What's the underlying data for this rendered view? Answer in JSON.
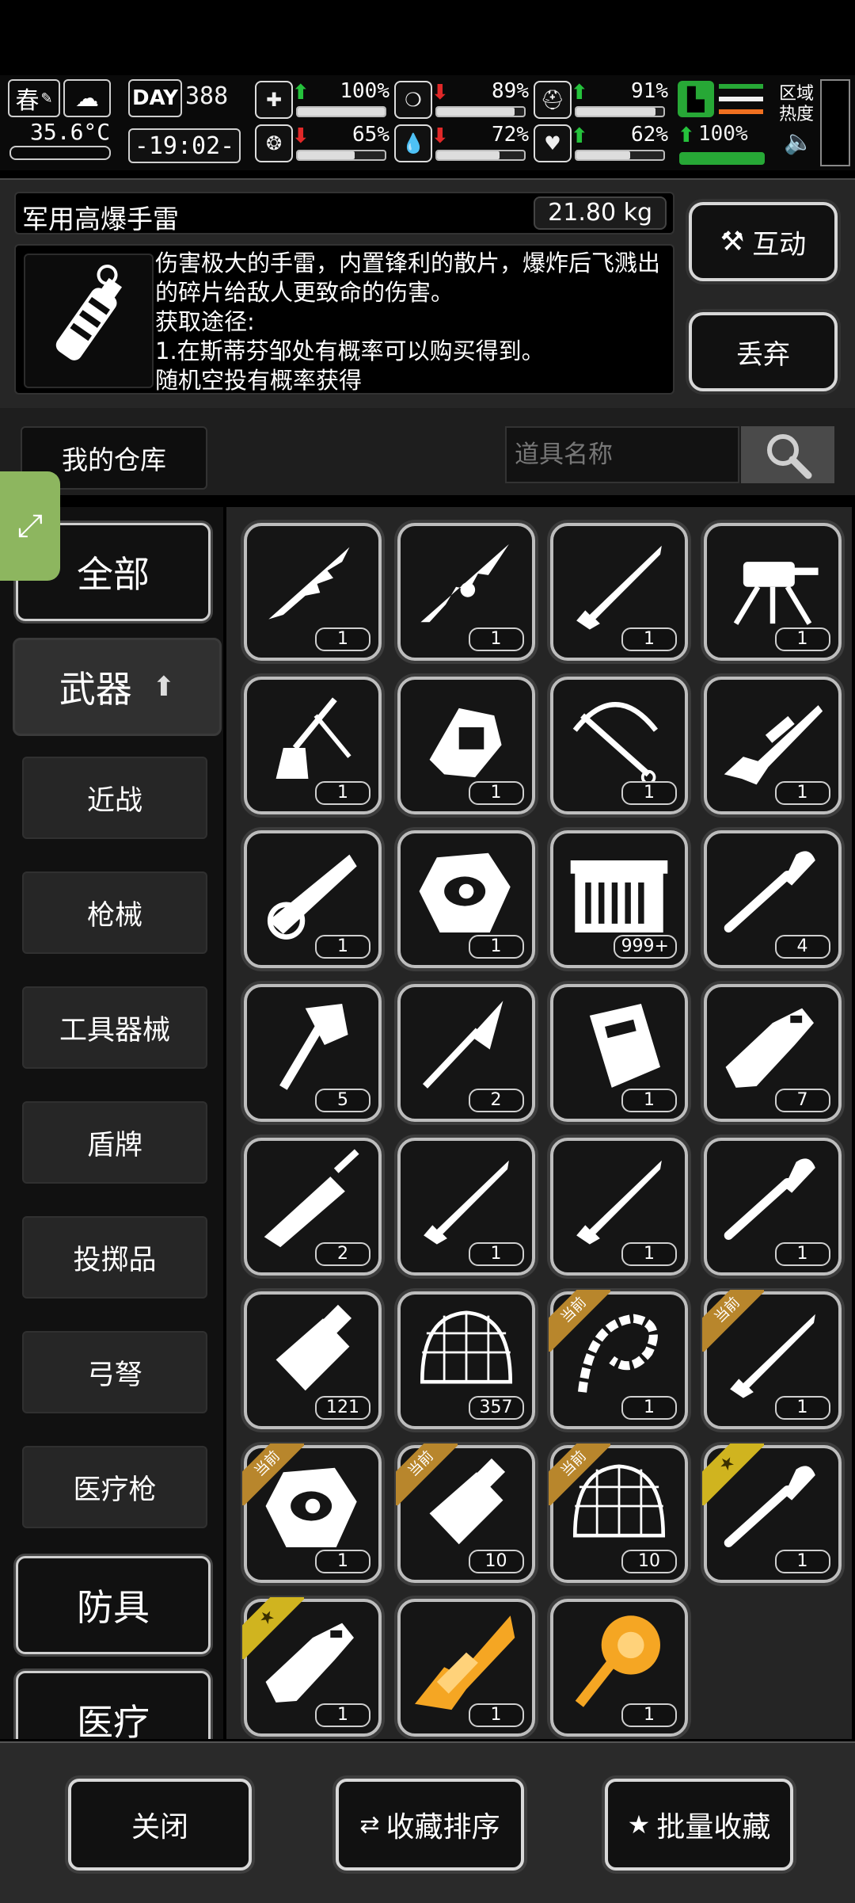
{
  "status": {
    "season": "春",
    "temperature": "35.6°C",
    "day_label": "DAY",
    "day_number": "388",
    "clock": "-19:02-",
    "region_heat_label": "区域\n热度",
    "stats": [
      {
        "name": "health",
        "icon": "medkit-icon",
        "trend": "up",
        "value": "100%",
        "level": 1.0
      },
      {
        "name": "hunger",
        "icon": "stomach-icon",
        "trend": "down",
        "value": "89%",
        "level": 0.89
      },
      {
        "name": "defense",
        "icon": "helmet-icon",
        "trend": "up",
        "value": "91%",
        "level": 0.91
      },
      {
        "name": "mind",
        "icon": "brain-icon",
        "trend": "down",
        "value": "65%",
        "level": 0.65
      },
      {
        "name": "water",
        "icon": "water-drop-icon",
        "trend": "down",
        "value": "72%",
        "level": 0.72
      },
      {
        "name": "mood",
        "icon": "heart-icon",
        "trend": "up",
        "value": "62%",
        "level": 0.62
      }
    ],
    "stamina": {
      "trend": "up",
      "value": "100%",
      "level": 1.0
    }
  },
  "detail": {
    "name": "军用高爆手雷",
    "weight": "21.80 kg",
    "description": "伤害极大的手雷，内置锋利的散片，爆炸后飞溅出的碎片给敌人更致命的伤害。\n获取途径:\n1.在斯蒂芬邹处有概率可以购买得到。\n随机空投有概率获得",
    "interact_label": "互动",
    "discard_label": "丢弃"
  },
  "warehouse": {
    "title": "我的仓库",
    "search_placeholder": "道具名称"
  },
  "categories": {
    "all": "全部",
    "weapons": "武器",
    "subs": [
      "近战",
      "枪械",
      "工具器械",
      "盾牌",
      "投掷品",
      "弓弩",
      "医疗枪"
    ],
    "armor": "防具",
    "medical": "医疗"
  },
  "ribbons": {
    "current": "当前"
  },
  "items": [
    {
      "icon": "jagged-spear-icon",
      "count": "1"
    },
    {
      "icon": "ornate-spear-icon",
      "count": "1"
    },
    {
      "icon": "katana-icon",
      "count": "1"
    },
    {
      "icon": "mounted-gun-icon",
      "count": "1"
    },
    {
      "icon": "guitar-axe-icon",
      "count": "1"
    },
    {
      "icon": "gauntlet-cannon-icon",
      "count": "1"
    },
    {
      "icon": "crossbow-icon",
      "count": "1"
    },
    {
      "icon": "sniper-rifle-icon",
      "count": "1"
    },
    {
      "icon": "chainsaw-icon",
      "count": "1"
    },
    {
      "icon": "eye-shield-icon",
      "count": "1"
    },
    {
      "icon": "ammo-crate-icon",
      "count": "999+"
    },
    {
      "icon": "shovel-icon",
      "count": "4"
    },
    {
      "icon": "hatchet-icon",
      "count": "5"
    },
    {
      "icon": "spear-tip-icon",
      "count": "2"
    },
    {
      "icon": "riot-shield-icon",
      "count": "1"
    },
    {
      "icon": "cleaver-icon",
      "count": "7"
    },
    {
      "icon": "broad-sword-icon",
      "count": "2"
    },
    {
      "icon": "katana-icon",
      "count": "1"
    },
    {
      "icon": "katana-icon",
      "count": "1"
    },
    {
      "icon": "shovel-icon",
      "count": "1"
    },
    {
      "icon": "throwing-bottle-icon",
      "count": "121"
    },
    {
      "icon": "net-icon",
      "count": "357"
    },
    {
      "icon": "bone-whip-icon",
      "count": "1",
      "ribbon": "current"
    },
    {
      "icon": "katana-icon",
      "count": "1",
      "ribbon": "current"
    },
    {
      "icon": "eye-shield-icon",
      "count": "1",
      "ribbon": "current"
    },
    {
      "icon": "throwing-bottle-icon",
      "count": "10",
      "ribbon": "current"
    },
    {
      "icon": "net-icon",
      "count": "10",
      "ribbon": "current"
    },
    {
      "icon": "shovel-icon",
      "count": "1",
      "ribbon": "star"
    },
    {
      "icon": "cleaver-icon",
      "count": "1",
      "ribbon": "star"
    },
    {
      "icon": "golden-rifle-icon",
      "count": "1",
      "color": "#f5a623"
    },
    {
      "icon": "golden-mace-icon",
      "count": "1",
      "color": "#f5a623"
    }
  ],
  "bottom": {
    "close": "关闭",
    "sort_favorites": "收藏排序",
    "batch_favorite": "批量收藏"
  }
}
